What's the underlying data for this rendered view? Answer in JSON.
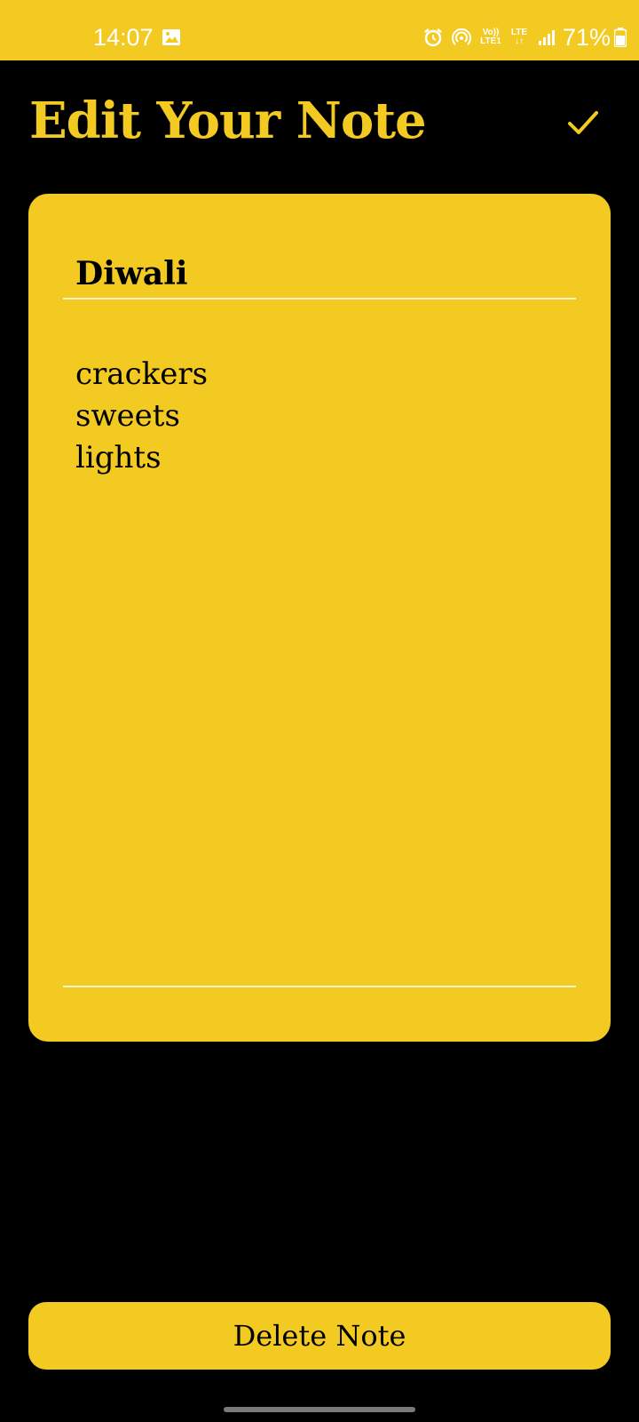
{
  "status_bar": {
    "time": "14:07",
    "gallery_icon": "image-icon",
    "alarm_icon": "alarm-icon",
    "hotspot_icon": "hotspot-icon",
    "volte_label_top": "Vo))",
    "volte_label_bottom": "LTE1",
    "lte_label_top": "LTE",
    "lte_label_bottom": "↓↑",
    "signal_icon": "signal-icon",
    "battery_percent": "71%",
    "battery_icon": "battery-icon",
    "background_color": "#F3CA22"
  },
  "header": {
    "title": "Edit Your Note",
    "confirm_icon": "check-icon"
  },
  "note": {
    "title_value": "Diwali",
    "body_value": "crackers\nsweets\nlights"
  },
  "actions": {
    "delete_label": "Delete Note"
  },
  "colors": {
    "accent": "#F3CA22",
    "background": "#000000",
    "underline": "#FBF3CF"
  }
}
